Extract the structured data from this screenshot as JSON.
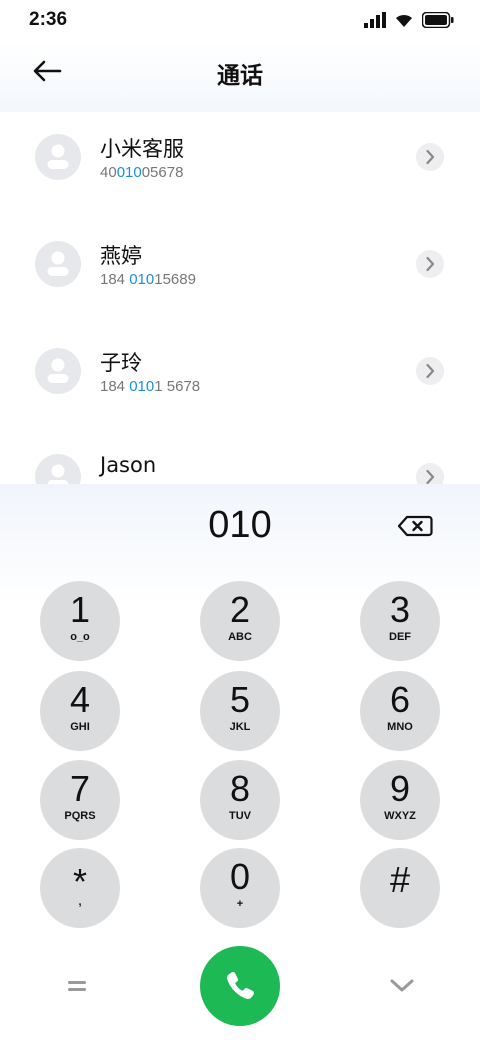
{
  "status_bar": {
    "time": "2:36",
    "icons": [
      "signal-icon",
      "wifi-icon",
      "battery-icon"
    ]
  },
  "header": {
    "title": "通话",
    "back_icon": "back-arrow-icon"
  },
  "contacts": [
    {
      "name": "小米客服",
      "number_pre": "40",
      "number_match": "010",
      "number_post": "05678"
    },
    {
      "name": "燕婷",
      "number_pre": "184 ",
      "number_match": "010",
      "number_post": "15689"
    },
    {
      "name": "子玲",
      "number_pre": "184 ",
      "number_match": "010",
      "number_post": "1 5678"
    },
    {
      "name": "Jason",
      "number_pre": "",
      "number_match": "",
      "number_post": ""
    }
  ],
  "dialpad": {
    "input_value": "010",
    "keys": [
      {
        "digit": "1",
        "letters": "o_o"
      },
      {
        "digit": "2",
        "letters": "ABC"
      },
      {
        "digit": "3",
        "letters": "DEF"
      },
      {
        "digit": "4",
        "letters": "GHI"
      },
      {
        "digit": "5",
        "letters": "JKL"
      },
      {
        "digit": "6",
        "letters": "MNO"
      },
      {
        "digit": "7",
        "letters": "PQRS"
      },
      {
        "digit": "8",
        "letters": "TUV"
      },
      {
        "digit": "9",
        "letters": "WXYZ"
      },
      {
        "digit": "*",
        "letters": ","
      },
      {
        "digit": "0",
        "letters": "+"
      },
      {
        "digit": "#",
        "letters": ""
      }
    ]
  },
  "colors": {
    "accent_match": "#1a8fe0",
    "call_button": "#1db954",
    "key_background": "#dbdcde"
  }
}
